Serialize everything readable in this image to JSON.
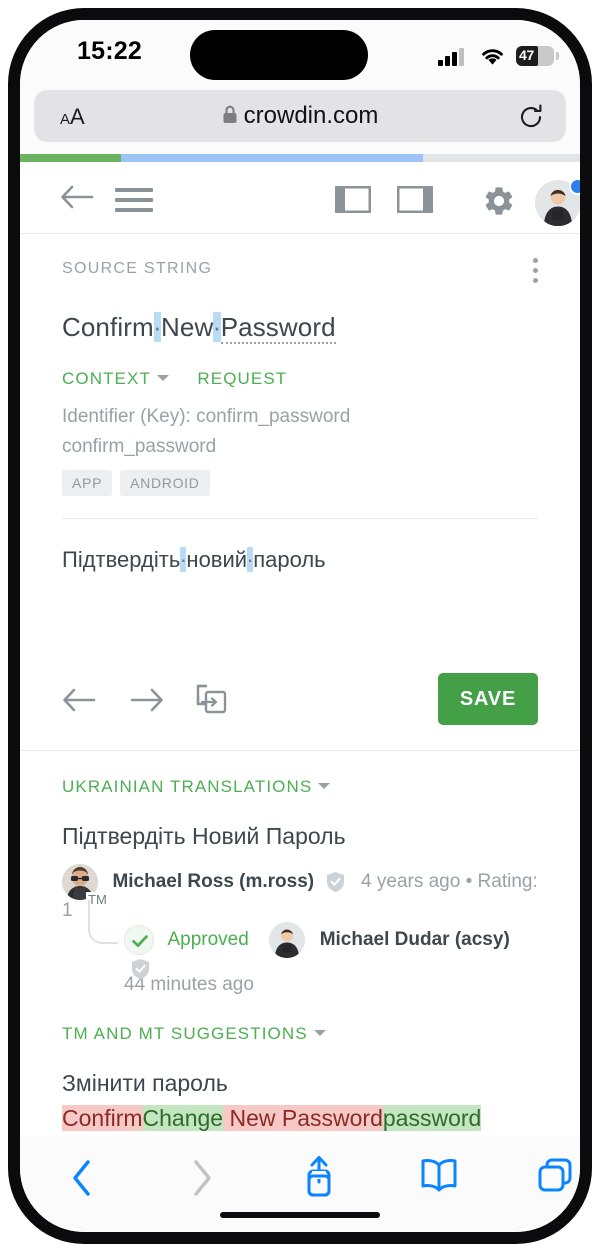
{
  "status_bar": {
    "time": "15:22",
    "battery_level": "47",
    "signal_icon": "cellular-signal-icon",
    "wifi_icon": "wifi-icon",
    "battery_icon": "battery-icon"
  },
  "safari": {
    "text_size_small": "A",
    "text_size_large": "A",
    "url": "crowdin.com",
    "lock_icon": "lock-icon",
    "reload_icon": "reload-icon",
    "toolbar": {
      "back_icon": "chevron-left-icon",
      "forward_icon": "chevron-right-icon",
      "share_icon": "share-icon",
      "bookmarks_icon": "book-icon",
      "tabs_icon": "tabs-icon"
    }
  },
  "progress": {
    "translated_percent": 18,
    "approved_percent": 54,
    "translated_color": "#6ab45f",
    "approved_color": "#9cc4f7",
    "track_color": "#e2e4e5"
  },
  "app_toolbar": {
    "back_icon": "arrow-left-icon",
    "menu_icon": "hamburger-menu-icon",
    "left_panel_icon": "toggle-left-panel-icon",
    "right_panel_icon": "toggle-right-panel-icon",
    "settings_icon": "gear-icon",
    "avatar_icon": "user-avatar",
    "notification_dot_color": "#2f80ed"
  },
  "source": {
    "label": "SOURCE STRING",
    "kebab_icon": "more-options-icon",
    "words": [
      "Confirm",
      "New",
      "Password"
    ],
    "tabs": [
      {
        "label": "CONTEXT",
        "has_caret": true
      },
      {
        "label": "REQUEST",
        "has_caret": false
      }
    ],
    "identifier_line": "Identifier (Key): confirm_password",
    "key_line": "confirm_password",
    "tags": [
      "APP",
      "ANDROID"
    ]
  },
  "editor": {
    "translation_words": [
      "Підтвердіть",
      "новий",
      "пароль"
    ],
    "prev_icon": "arrow-left-icon",
    "next_icon": "arrow-right-icon",
    "copy_source_icon": "copy-source-icon",
    "save_label": "SAVE",
    "save_color": "#43a047"
  },
  "translations": {
    "header": "UKRAINIAN TRANSLATIONS",
    "text": "Підтвердіть Новий Пароль",
    "author_name": "Michael Ross (m.ross)",
    "author_badge_icon": "verified-shield-icon",
    "tm_badge": "TM",
    "meta": "4 years ago  •  Rating: 1",
    "approved_label": "Approved",
    "approved_check_icon": "check-icon",
    "approver_name": "Michael Dudar (acsy)",
    "approver_badge_icon": "verified-shield-icon",
    "approval_time": "44 minutes ago"
  },
  "suggestions": {
    "header": "TM AND MT SUGGESTIONS",
    "text": "Змінити пароль",
    "diff": [
      {
        "text": "Confirm",
        "type": "deleted"
      },
      {
        "text": "Change",
        "type": "inserted"
      },
      {
        "text": " New Password",
        "type": "deleted"
      },
      {
        "text": "password",
        "type": "inserted"
      }
    ]
  }
}
